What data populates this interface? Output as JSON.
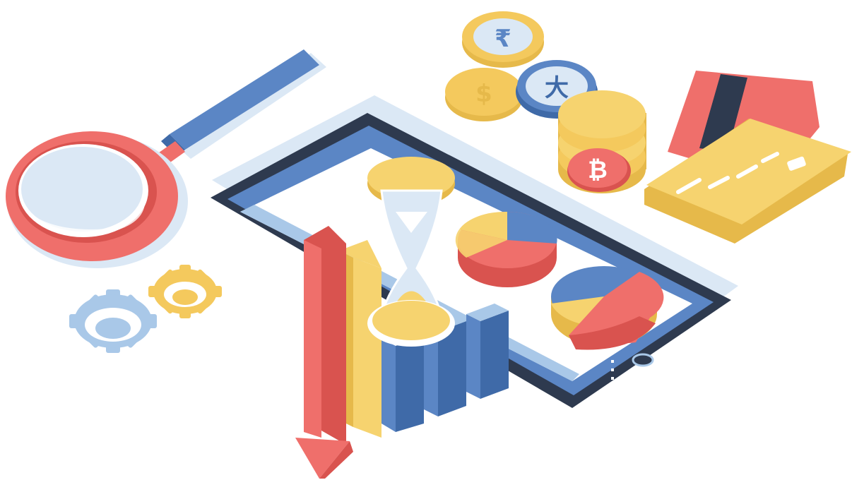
{
  "scene": {
    "kind": "isometric finance illustration",
    "background": "#ffffff"
  },
  "palette": {
    "coral": "#ef6f6b",
    "coral_dark": "#d9534f",
    "blue": "#5b86c5",
    "blue_dark": "#3f6aa8",
    "yellow": "#f6d36f",
    "yellow_dark": "#e6b94a",
    "gold": "#f4c95d",
    "light_blue": "#a9c8e8",
    "pale_blue": "#dbe8f5",
    "navy": "#2e3a4f",
    "white": "#ffffff"
  },
  "coins": {
    "top": {
      "symbol": "₹"
    },
    "blue": {
      "symbol": "大"
    },
    "left": {
      "symbol": "$"
    },
    "stack": {
      "symbol": "₿"
    }
  },
  "icons": [
    "magnifying-glass-icon",
    "gear-icon",
    "smartphone-icon",
    "hourglass-icon",
    "pie-chart-icon",
    "bar-chart-icon",
    "down-arrow-icon",
    "coin-icon",
    "credit-card-icon"
  ]
}
